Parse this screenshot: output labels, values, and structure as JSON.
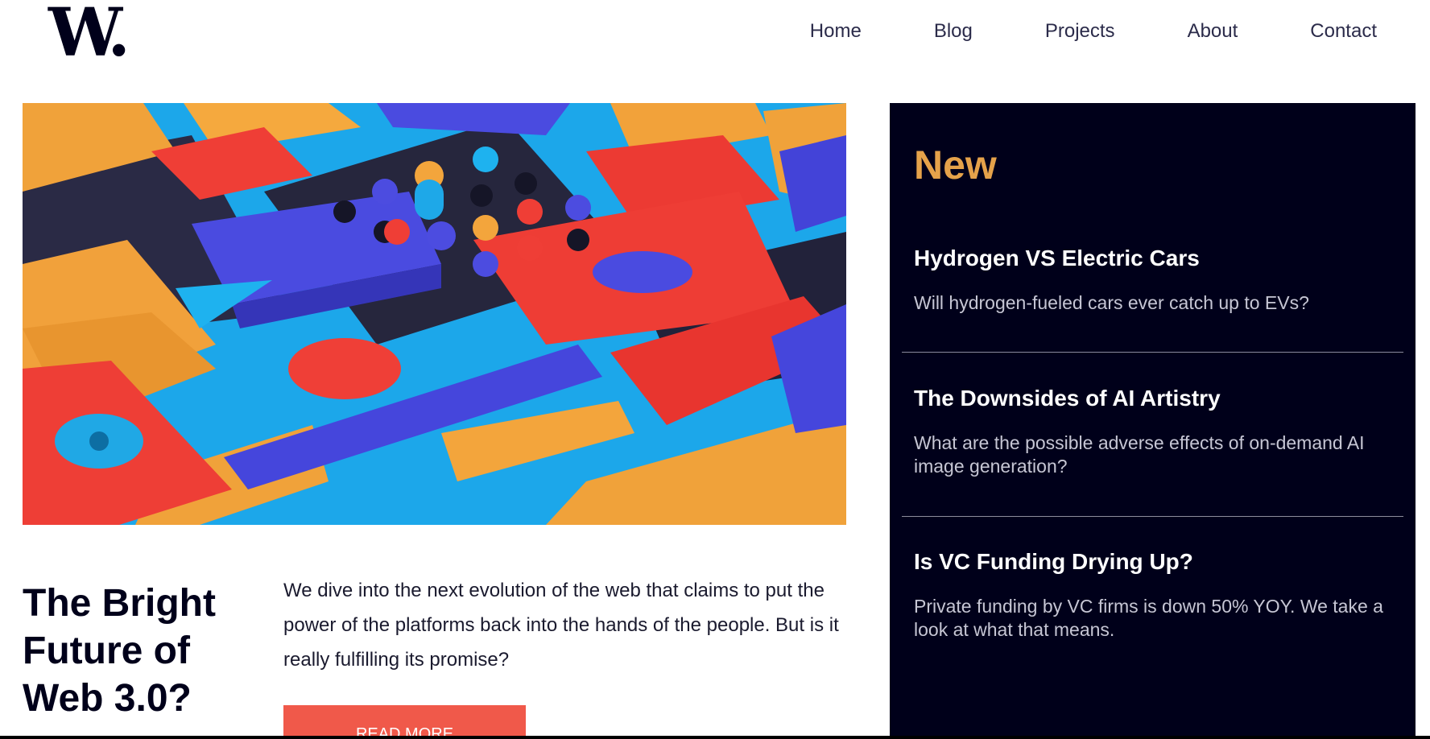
{
  "header": {
    "logo": "W.",
    "nav": [
      "Home",
      "Blog",
      "Projects",
      "About",
      "Contact"
    ]
  },
  "main_article": {
    "title": "The Bright Future of Web 3.0?",
    "body": "We dive into the next evolution of the web that claims to put the power of the platforms back into the hands of the people. But is it really fulfilling its promise?",
    "cta": "READ MORE"
  },
  "sidebar": {
    "heading": "New",
    "items": [
      {
        "title": "Hydrogen VS Electric Cars",
        "summary": "Will hydrogen-fueled cars ever catch up to EVs?"
      },
      {
        "title": "The Downsides of AI Artistry",
        "summary": "What are the possible adverse effects of on-demand AI image generation?"
      },
      {
        "title": "Is VC Funding Drying Up?",
        "summary": "Private funding by VC firms is down 50% YOY. We take a look at what that means."
      }
    ]
  },
  "colors": {
    "accent": "#e5a24a",
    "cta": "#f0594a",
    "sidebar_bg": "#00001a",
    "text_dark": "#00001a"
  }
}
